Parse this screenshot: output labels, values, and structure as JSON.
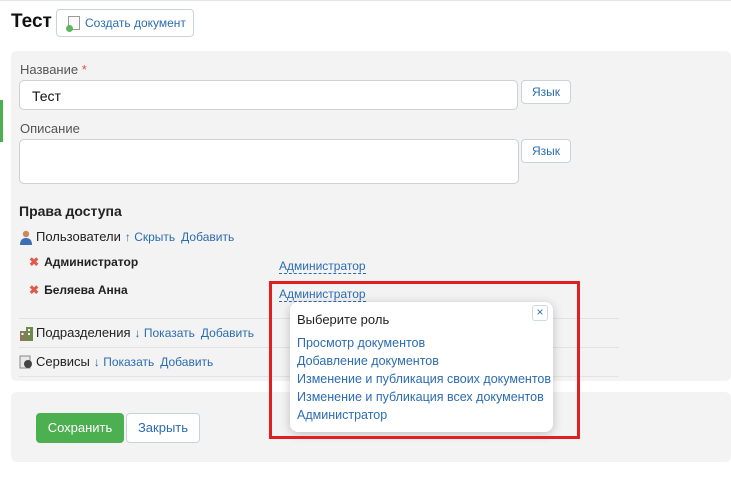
{
  "header": {
    "title": "Тест",
    "create_button": "Создать документ"
  },
  "form": {
    "name_label": "Название",
    "required_mark": "*",
    "name_value": "Тест",
    "description_label": "Описание",
    "description_value": "",
    "lang_button": "Язык"
  },
  "access": {
    "title": "Права доступа",
    "users": {
      "label": "Пользователи",
      "toggle": "↑ Скрыть",
      "add": "Добавить",
      "list": [
        {
          "name": "Администратор",
          "role": "Администратор"
        },
        {
          "name": "Беляева Анна",
          "role": "Администратор"
        }
      ]
    },
    "departments": {
      "label": "Подразделения",
      "toggle": "↓ Показать",
      "add": "Добавить"
    },
    "services": {
      "label": "Сервисы",
      "toggle": "↓ Показать",
      "add": "Добавить"
    }
  },
  "footer": {
    "save": "Сохранить",
    "close": "Закрыть"
  },
  "role_popup": {
    "title": "Выберите роль",
    "close": "×",
    "roles": [
      "Просмотр документов",
      "Добавление документов",
      "Изменение и публикация своих документов",
      "Изменение и публикация всех документов",
      "Администратор"
    ]
  },
  "colors": {
    "accent": "#2b6cb0",
    "save": "#4caf50",
    "highlight": "#e02020",
    "remove": "#e05a4a"
  }
}
